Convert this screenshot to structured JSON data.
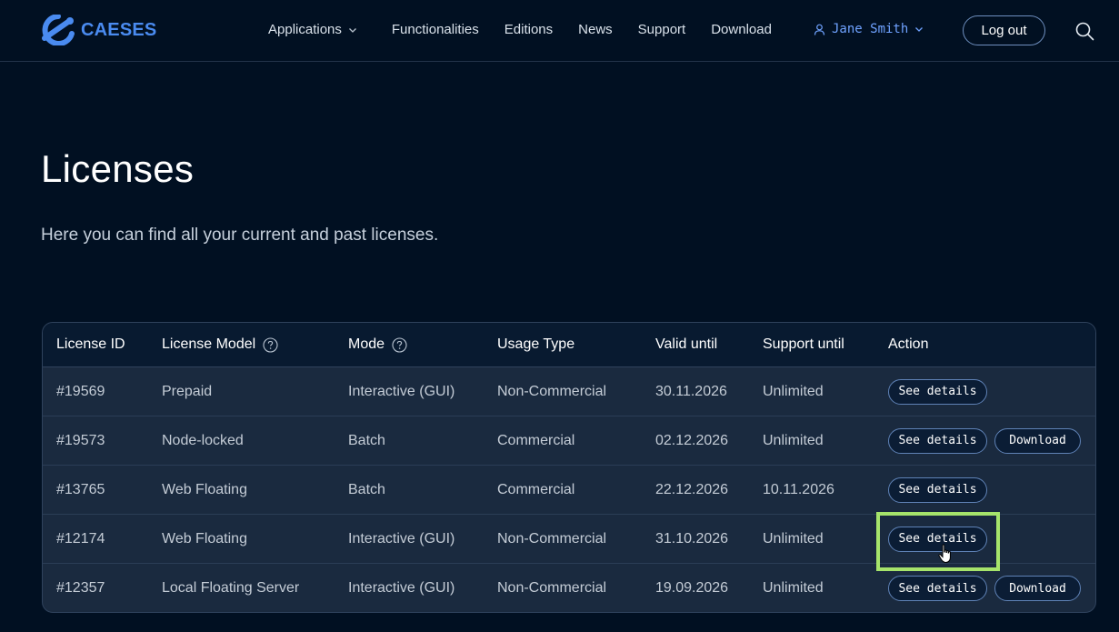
{
  "header": {
    "brand": "CAESES",
    "nav": [
      {
        "label": "Applications",
        "has_dropdown": true
      },
      {
        "label": "Functionalities",
        "has_dropdown": false
      },
      {
        "label": "Editions",
        "has_dropdown": false
      },
      {
        "label": "News",
        "has_dropdown": false
      },
      {
        "label": "Support",
        "has_dropdown": false
      },
      {
        "label": "Download",
        "has_dropdown": false
      }
    ],
    "user_name": "Jane Smith",
    "logout_label": "Log out",
    "search_icon": "search-icon"
  },
  "page": {
    "title": "Licenses",
    "subtitle": "Here you can find all your current and past licenses."
  },
  "table": {
    "headers": [
      "License ID",
      "License Model",
      "Mode",
      "Usage Type",
      "Valid until",
      "Support until",
      "Action"
    ],
    "help_icons_on": [
      "License Model",
      "Mode"
    ],
    "rows": [
      {
        "id": "#19569",
        "model": "Prepaid",
        "mode": "Interactive (GUI)",
        "usage": "Non-Commercial",
        "valid": "30.11.2026",
        "support": "Unlimited",
        "actions": [
          "See details"
        ]
      },
      {
        "id": "#19573",
        "model": "Node-locked",
        "mode": "Batch",
        "usage": "Commercial",
        "valid": "02.12.2026",
        "support": "Unlimited",
        "actions": [
          "See details",
          "Download"
        ]
      },
      {
        "id": "#13765",
        "model": "Web Floating",
        "mode": "Batch",
        "usage": "Commercial",
        "valid": "22.12.2026",
        "support": "10.11.2026",
        "actions": [
          "See details"
        ]
      },
      {
        "id": "#12174",
        "model": "Web Floating",
        "mode": "Interactive (GUI)",
        "usage": "Non-Commercial",
        "valid": "31.10.2026",
        "support": "Unlimited",
        "actions": [
          "See details"
        ]
      },
      {
        "id": "#12357",
        "model": "Local Floating Server",
        "mode": "Interactive (GUI)",
        "usage": "Non-Commercial",
        "valid": "19.09.2026",
        "support": "Unlimited",
        "actions": [
          "See details",
          "Download"
        ]
      }
    ]
  },
  "colors": {
    "background": "#011022",
    "brand_blue": "#4a8bf0",
    "user_link": "#6fa2ff",
    "highlight": "#a6e46b"
  }
}
